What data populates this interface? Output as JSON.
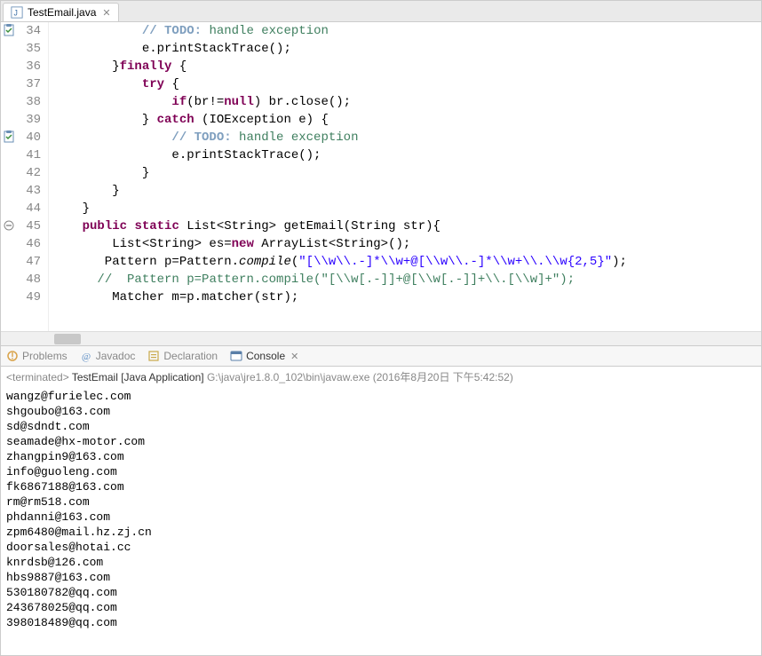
{
  "editor": {
    "tab": {
      "label": "TestEmail.java",
      "close": "✕"
    },
    "lines": [
      {
        "n": 34,
        "marker": "task",
        "html": "            <span class='com'><span class='todo'>// TODO:</span> handle exception</span>"
      },
      {
        "n": 35,
        "html": "            e.printStackTrace();"
      },
      {
        "n": 36,
        "html": "        }<span class='kw'>finally</span> {"
      },
      {
        "n": 37,
        "html": "            <span class='kw'>try</span> {"
      },
      {
        "n": 38,
        "html": "                <span class='kw'>if</span>(br!=<span class='kw'>null</span>) br.close();"
      },
      {
        "n": 39,
        "html": "            } <span class='kw'>catch</span> (IOException e) {"
      },
      {
        "n": 40,
        "marker": "task",
        "html": "                <span class='com'><span class='todo'>// TODO:</span> handle exception</span>"
      },
      {
        "n": 41,
        "html": "                e.printStackTrace();"
      },
      {
        "n": 42,
        "html": "            }"
      },
      {
        "n": 43,
        "html": "        }"
      },
      {
        "n": 44,
        "html": "    }"
      },
      {
        "n": 45,
        "marker": "fold",
        "html": "    <span class='kw'>public</span> <span class='kw'>static</span> List&lt;String&gt; getEmail(String str){"
      },
      {
        "n": 46,
        "html": "        List&lt;String&gt; es=<span class='kw'>new</span> ArrayList&lt;String&gt;();"
      },
      {
        "n": 47,
        "html": "       Pattern p=Pattern.<span class='it'>compile</span>(<span class='str'>\"[\\\\w\\\\.-]*\\\\w+@[\\\\w\\\\.-]*\\\\w+\\\\.\\\\w{2,5}\"</span>);"
      },
      {
        "n": 48,
        "html": "      <span class='com'>//  Pattern p=Pattern.compile(\"[\\\\w[.-]]+@[\\\\w[.-]]+\\\\.[\\\\w]+\");</span>"
      },
      {
        "n": 49,
        "html": "        Matcher m=p.matcher(str);"
      }
    ]
  },
  "views": {
    "problems": "Problems",
    "javadoc": "Javadoc",
    "declaration": "Declaration",
    "console": "Console",
    "close": "✕"
  },
  "console": {
    "status": "<terminated>",
    "launch": "TestEmail [Java Application]",
    "path": "G:\\java\\jre1.8.0_102\\bin\\javaw.exe",
    "timestamp": "(2016年8月20日 下午5:42:52)",
    "output": [
      "wangz@furielec.com",
      "shgoubo@163.com",
      "sd@sdndt.com",
      "seamade@hx-motor.com",
      "zhangpin9@163.com",
      "info@guoleng.com",
      "fk6867188@163.com",
      "rm@rm518.com",
      "phdanni@163.com",
      "zpm6480@mail.hz.zj.cn",
      "doorsales@hotai.cc",
      "knrdsb@126.com",
      "hbs9887@163.com",
      "530180782@qq.com",
      "243678025@qq.com",
      "398018489@qq.com"
    ]
  }
}
